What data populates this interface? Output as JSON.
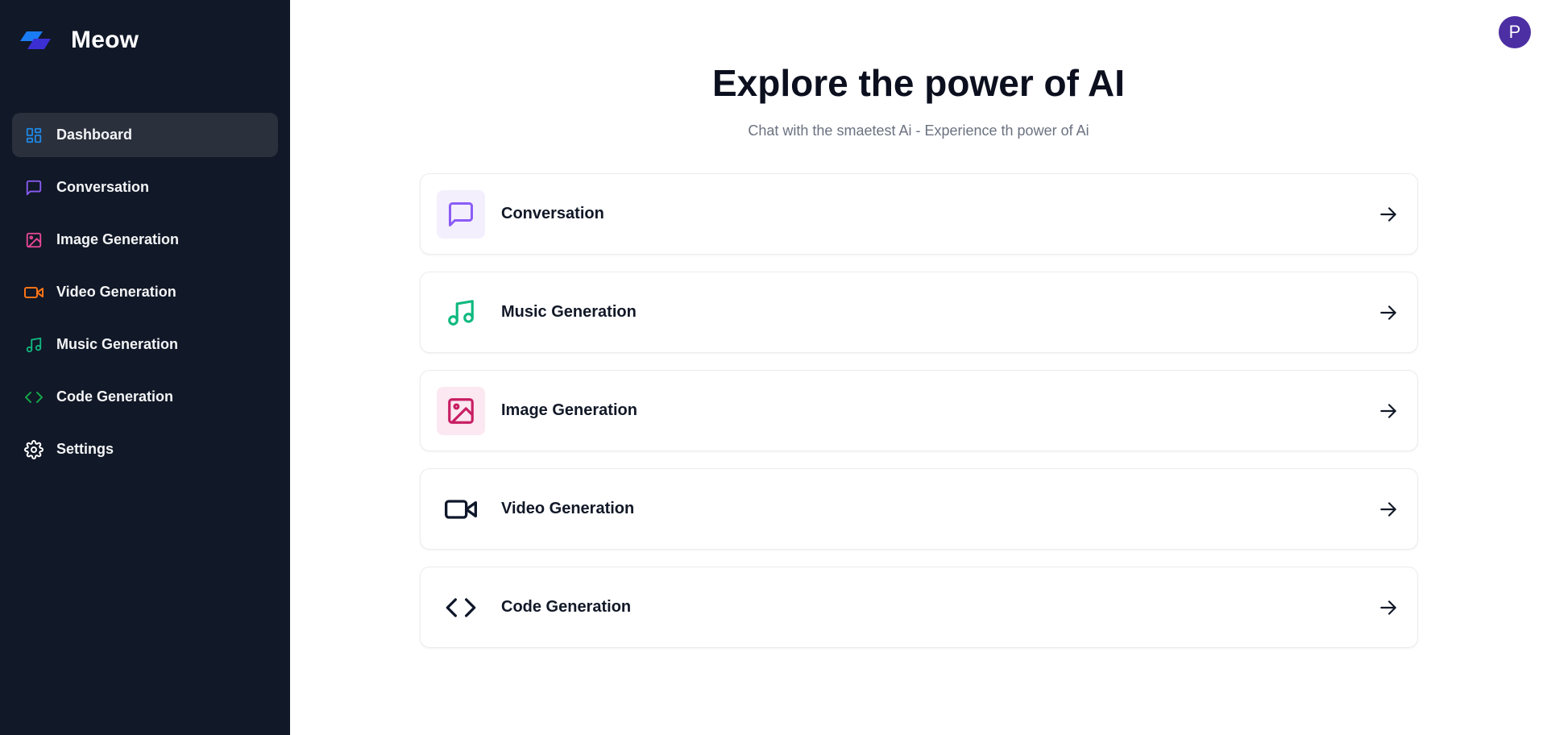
{
  "app": {
    "name": "Meow"
  },
  "sidebar": {
    "items": [
      {
        "label": "Dashboard",
        "icon": "dashboard-icon",
        "color": "#1e88e5",
        "active": true
      },
      {
        "label": "Conversation",
        "icon": "message-square-icon",
        "color": "#8b5cf6"
      },
      {
        "label": "Image Generation",
        "icon": "image-icon",
        "color": "#ec4899"
      },
      {
        "label": "Video Generation",
        "icon": "video-icon",
        "color": "#f97316"
      },
      {
        "label": "Music Generation",
        "icon": "music-icon",
        "color": "#10b981"
      },
      {
        "label": "Code Generation",
        "icon": "code-icon",
        "color": "#16a34a"
      },
      {
        "label": "Settings",
        "icon": "settings-icon",
        "color": "#ffffff"
      }
    ]
  },
  "user": {
    "avatar_initial": "P",
    "avatar_color": "#4c2fa3"
  },
  "main": {
    "title": "Explore the power of AI",
    "subtitle": "Chat with the smaetest Ai - Experience th power of Ai",
    "cards": [
      {
        "label": "Conversation",
        "icon": "message-square-icon",
        "color": "#8b5cf6",
        "bg": "#f3effd"
      },
      {
        "label": "Music Generation",
        "icon": "music-icon",
        "color": "#10b981",
        "bg": ""
      },
      {
        "label": "Image Generation",
        "icon": "image-icon",
        "color": "#c81e63",
        "bg": "#fbe8f0"
      },
      {
        "label": "Video Generation",
        "icon": "video-icon",
        "color": "#0f172a",
        "bg": ""
      },
      {
        "label": "Code Generation",
        "icon": "code-icon",
        "color": "#0f172a",
        "bg": ""
      }
    ]
  }
}
